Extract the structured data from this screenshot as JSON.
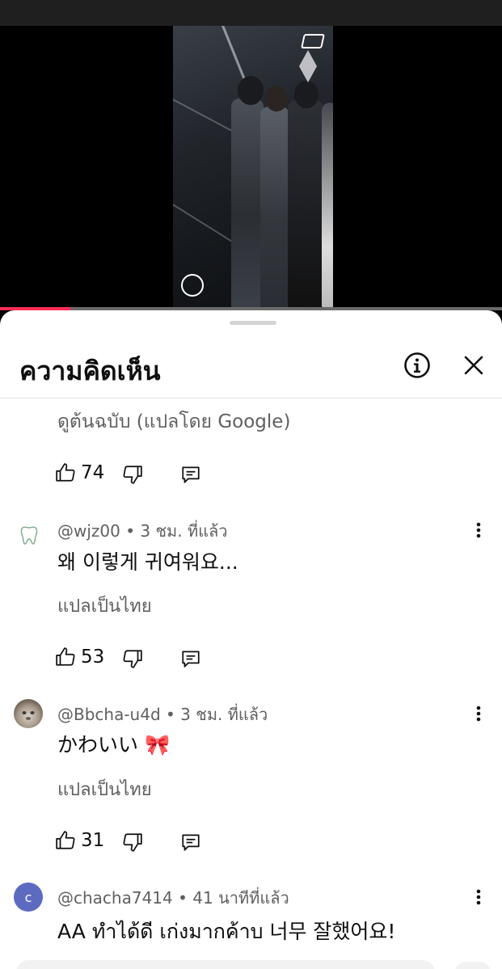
{
  "header": {
    "title": "ความคิดเห็น",
    "info_icon": "info-circle-icon",
    "close_icon": "close-icon"
  },
  "video": {
    "progress_fraction": 0.14,
    "accent_color": "#ff2d55"
  },
  "first_comment_tail": {
    "see_original": "ดูต้นฉบับ (แปลโดย Google)",
    "likes": "74"
  },
  "comments": [
    {
      "author": "@wjz00",
      "time": "3 ชม. ที่แล้ว",
      "text": "왜 이렇게 귀여워요...",
      "translate": "แปลเป็นไทย",
      "likes": "53",
      "avatar": "tooth-avatar"
    },
    {
      "author": "@Bbcha-u4d",
      "time": "3 ชม. ที่แล้ว",
      "text": "かわいい 🎀",
      "translate": "แปลเป็นไทย",
      "likes": "31",
      "avatar": "cat-avatar"
    },
    {
      "author": "@chacha7414",
      "time": "41 นาทีที่แล้ว",
      "text": "AA ทำได้ดี เก่งมากค้าบ 너무 잘했어요!",
      "avatar_letter": "c",
      "avatar_color": "#5c6bc0"
    }
  ],
  "separator": "•",
  "icons": {
    "like": "thumbs-up-icon",
    "dislike": "thumbs-down-icon",
    "reply": "reply-icon",
    "more": "more-vertical-icon"
  }
}
